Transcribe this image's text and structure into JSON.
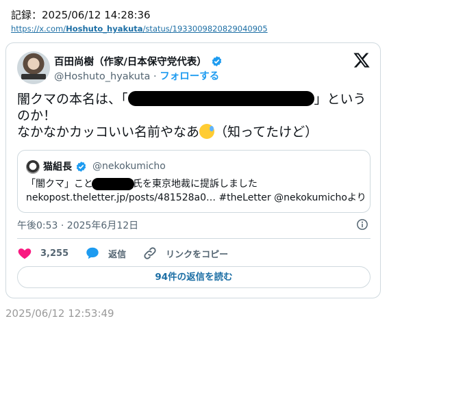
{
  "record": {
    "label": "記録：2025/06/12 14:28:36"
  },
  "url": {
    "prefix": "https://x.com/",
    "user": "Hoshuto_hyakuta",
    "suffix": "/status/1933009820829040905"
  },
  "tweet": {
    "author_name": "百田尚樹（作家/日本保守党代表）",
    "handle": "@Hoshuto_hyakuta",
    "separator": " · ",
    "follow_label": "フォローする",
    "text_part1": "闇クマの本名は、「",
    "text_part2": "」というのか！",
    "text_line2": "なかなかカッコいい名前やなあ",
    "text_line2_end": "（知ってたけど）",
    "emoji": "grinning-sweat-emoji",
    "timestamp": "午後0:53 · 2025年6月12日",
    "likes": "3,255",
    "reply_label": "返信",
    "copy_link_label": "リンクをコピー",
    "read_replies_label": "94件の返信を読む"
  },
  "quote": {
    "author_name": "猫組長",
    "handle": "@nekokumicho",
    "line1_prefix": "「闇クマ」こと",
    "line1_suffix": "氏を東京地裁に提訴しました",
    "line2": "nekopost.theletter.jp/posts/481528a0… #theLetter @nekokumichoより"
  },
  "saved_timestamp": "2025/06/12 12:53:49",
  "colors": {
    "verified": "#1d9bf0",
    "like": "#f91880",
    "reply": "#1d9bf0",
    "link": "#1d6fa5"
  }
}
